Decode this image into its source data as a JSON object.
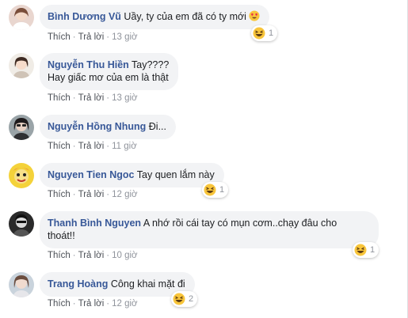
{
  "actions": {
    "like": "Thích",
    "reply": "Trả lời",
    "sep": "·"
  },
  "comments": [
    {
      "author": "Bình Dương Vũ",
      "text": "Uầy, ty của em đã có ty mới",
      "time": "13 giờ",
      "reaction": "love-eyes",
      "reaction_count": "1"
    },
    {
      "author": "Nguyễn Thu Hiền",
      "text_line1": "Tay????",
      "text_line2": "Hay giấc mơ của em là thật",
      "time": "13 giờ"
    },
    {
      "author": "Nguyễn Hồng Nhung",
      "text": "Đi...",
      "time": "11 giờ"
    },
    {
      "author": "Nguyen Tien Ngoc",
      "text": "Tay quen lắm này",
      "time": "12 giờ",
      "reaction": "haha",
      "reaction_count": "1"
    },
    {
      "author": "Thanh Bình Nguyen",
      "text_line1": "A nhớ rồi cái tay có mụn cơm..chạy đâu cho",
      "text_line2": "thoát!!",
      "time": "10 giờ",
      "reaction": "haha",
      "reaction_count": "1"
    },
    {
      "author": "Trang Hoàng",
      "text": "Công khai mặt đi",
      "time": "12 giờ",
      "reaction": "haha",
      "reaction_count": "2"
    }
  ],
  "colors": {
    "author": "#385898",
    "bubble": "#f2f3f5",
    "meta": "#90949c",
    "link": "#4b4f56"
  }
}
